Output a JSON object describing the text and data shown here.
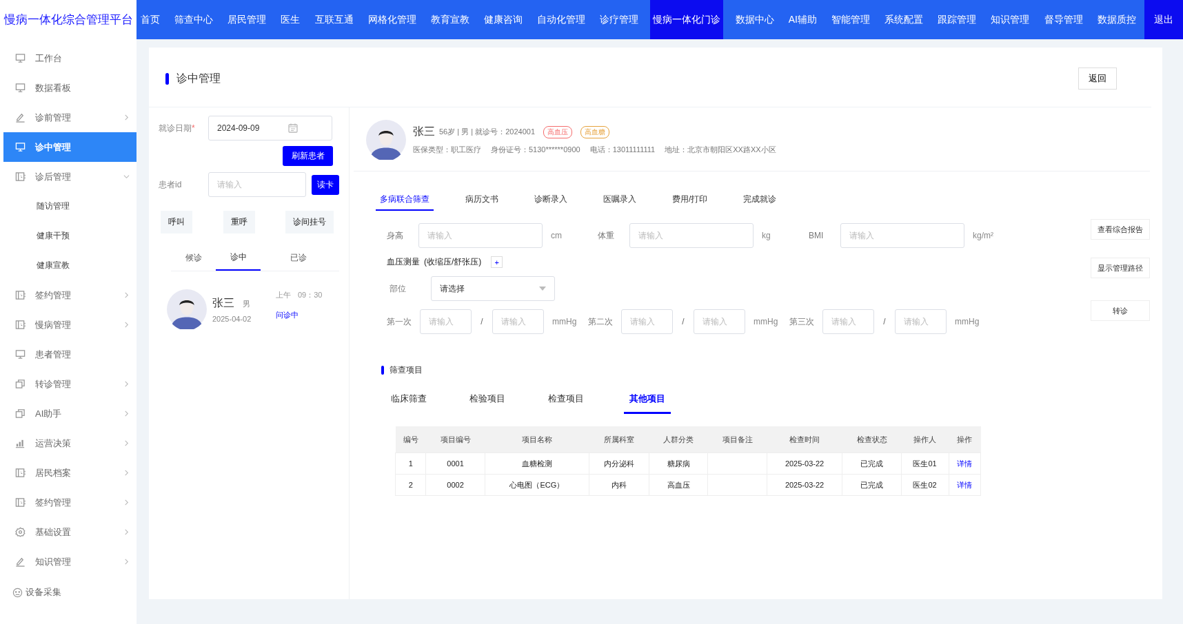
{
  "brand": "慢病一体化综合管理平台",
  "nav": [
    {
      "label": "首页",
      "selected": false
    },
    {
      "label": "筛查中心",
      "selected": false
    },
    {
      "label": "居民管理",
      "selected": false
    },
    {
      "label": "医生",
      "selected": false
    },
    {
      "label": "互联互通",
      "selected": false
    },
    {
      "label": "网格化管理",
      "selected": false
    },
    {
      "label": "教育宣教",
      "selected": false
    },
    {
      "label": "健康咨询",
      "selected": false
    },
    {
      "label": "自动化管理",
      "selected": false
    },
    {
      "label": "诊疗管理",
      "selected": false
    },
    {
      "label": "慢病一体化门诊",
      "selected": true
    },
    {
      "label": "数据中心",
      "selected": false
    },
    {
      "label": "AI辅助",
      "selected": false
    },
    {
      "label": "智能管理",
      "selected": false
    },
    {
      "label": "系统配置",
      "selected": false
    },
    {
      "label": "跟踪管理",
      "selected": false
    },
    {
      "label": "知识管理",
      "selected": false
    },
    {
      "label": "督导管理",
      "selected": false
    },
    {
      "label": "数据质控",
      "selected": false
    }
  ],
  "logout": "退出",
  "sidebar": {
    "items": [
      {
        "label": "工作台",
        "kind": "monitor",
        "selected": false
      },
      {
        "label": "数据看板",
        "kind": "monitor",
        "selected": false
      },
      {
        "label": "诊前管理",
        "kind": "pen",
        "selected": false,
        "expanded": false
      },
      {
        "label": "诊中管理",
        "kind": "monitor",
        "selected": true
      },
      {
        "label": "诊后管理",
        "kind": "contact",
        "selected": false,
        "expanded": true,
        "children": [
          {
            "label": "随访管理"
          },
          {
            "label": "健康干预"
          },
          {
            "label": "健康宣教"
          }
        ]
      },
      {
        "label": "签约管理",
        "kind": "contact",
        "selected": false,
        "expanded": false
      },
      {
        "label": "慢病管理",
        "kind": "contact",
        "selected": false,
        "expanded": false
      },
      {
        "label": "患者管理",
        "kind": "monitor",
        "selected": false
      },
      {
        "label": "转诊管理",
        "kind": "copy",
        "selected": false,
        "expanded": false
      },
      {
        "label": "AI助手",
        "kind": "copy",
        "selected": false,
        "expanded": false
      },
      {
        "label": "运营决策",
        "kind": "chart",
        "selected": false,
        "expanded": false
      },
      {
        "label": "居民档案",
        "kind": "contact",
        "selected": false,
        "expanded": false
      },
      {
        "label": "签约管理",
        "kind": "contact",
        "selected": false,
        "expanded": false
      },
      {
        "label": "基础设置",
        "kind": "gear",
        "selected": false,
        "expanded": false
      },
      {
        "label": "知识管理",
        "kind": "pen",
        "selected": false,
        "expanded": false
      }
    ],
    "footer": "设备采集"
  },
  "page_title": "诊中管理",
  "back_button": "返回",
  "queue": {
    "date_field": {
      "label": "就诊日期",
      "required_mark": "*",
      "value": "2024-09-09"
    },
    "refresh_button": "刷新患者",
    "patient_id": {
      "label": "患者id",
      "placeholder": "请输入"
    },
    "read_card_button": "读卡",
    "actions": [
      "呼叫",
      "重呼",
      "诊间挂号"
    ],
    "tabs": [
      {
        "label": "候诊",
        "selected": false
      },
      {
        "label": "诊中",
        "selected": true
      },
      {
        "label": "已诊",
        "selected": false
      }
    ],
    "patients": [
      {
        "name": "张三",
        "gender": "男",
        "date": "2025-04-02",
        "period": "上午",
        "time": "09：30",
        "status": "问诊中"
      }
    ]
  },
  "patient": {
    "name": "张三",
    "summary": "56岁 | 男 | 就诊号：2024001",
    "tags": [
      {
        "label": "高血压",
        "color": "#f56c6c"
      },
      {
        "label": "高血糖",
        "color": "#e6a23c"
      }
    ],
    "info": [
      "医保类型：职工医疗",
      "身份证号：5130******0900",
      "电话：13011111111",
      "地址：北京市朝阳区XX路XX小区"
    ]
  },
  "tabs": [
    {
      "label": "多病联合筛查",
      "selected": true
    },
    {
      "label": "病历文书",
      "selected": false
    },
    {
      "label": "诊断录入",
      "selected": false
    },
    {
      "label": "医嘱录入",
      "selected": false
    },
    {
      "label": "费用/打印",
      "selected": false
    },
    {
      "label": "完成就诊",
      "selected": false
    }
  ],
  "measures": [
    {
      "label": "身高",
      "placeholder": "请输入",
      "unit": "cm"
    },
    {
      "label": "体重",
      "placeholder": "请输入",
      "unit": "kg"
    },
    {
      "label": "BMI",
      "placeholder": "请输入",
      "unit": "kg/m²"
    }
  ],
  "blood_pressure": {
    "title": "血压测量",
    "note": "(收缩压/舒张压)",
    "add": "+",
    "site": {
      "label": "部位",
      "placeholder": "请选择"
    },
    "readings": [
      {
        "label": "第一次",
        "systolic_placeholder": "请输入",
        "separator": "/",
        "diastolic_placeholder": "请输入",
        "unit": "mmHg"
      },
      {
        "label": "第二次",
        "systolic_placeholder": "请输入",
        "separator": "/",
        "diastolic_placeholder": "请输入",
        "unit": "mmHg"
      },
      {
        "label": "第三次",
        "systolic_placeholder": "请输入",
        "separator": "/",
        "diastolic_placeholder": "请输入",
        "unit": "mmHg"
      }
    ]
  },
  "side_buttons": [
    "查看综合报告",
    "显示管理路径",
    "转诊"
  ],
  "screening": {
    "title": "筛查项目",
    "tabs": [
      {
        "label": "临床筛查",
        "selected": false
      },
      {
        "label": "检验项目",
        "selected": false
      },
      {
        "label": "检查项目",
        "selected": false
      },
      {
        "label": "其他项目",
        "selected": true
      }
    ],
    "table": {
      "columns": [
        "编号",
        "项目编号",
        "项目名称",
        "所属科室",
        "人群分类",
        "项目备注",
        "检查时间",
        "检查状态",
        "操作人",
        "操作"
      ],
      "rows": [
        {
          "cells": [
            "1",
            "0001",
            "血糖检测",
            "内分泌科",
            "糖尿病",
            "",
            "2025-03-22",
            "已完成",
            "医生01"
          ],
          "action": "详情"
        },
        {
          "cells": [
            "2",
            "0002",
            "心电图（ECG）",
            "内科",
            "高血压",
            "",
            "2025-03-22",
            "已完成",
            "医生02"
          ],
          "action": "详情"
        }
      ]
    }
  }
}
